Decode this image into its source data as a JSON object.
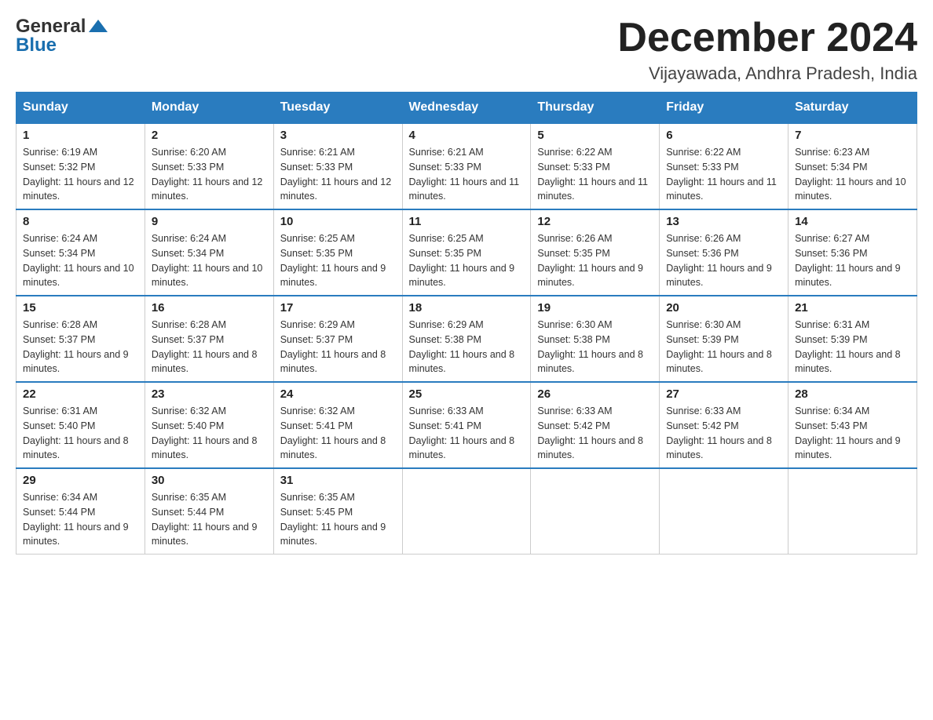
{
  "header": {
    "logo_general": "General",
    "logo_blue": "Blue",
    "month_title": "December 2024",
    "location": "Vijayawada, Andhra Pradesh, India"
  },
  "weekdays": [
    "Sunday",
    "Monday",
    "Tuesday",
    "Wednesday",
    "Thursday",
    "Friday",
    "Saturday"
  ],
  "weeks": [
    [
      {
        "day": "1",
        "sunrise": "6:19 AM",
        "sunset": "5:32 PM",
        "daylight": "11 hours and 12 minutes."
      },
      {
        "day": "2",
        "sunrise": "6:20 AM",
        "sunset": "5:33 PM",
        "daylight": "11 hours and 12 minutes."
      },
      {
        "day": "3",
        "sunrise": "6:21 AM",
        "sunset": "5:33 PM",
        "daylight": "11 hours and 12 minutes."
      },
      {
        "day": "4",
        "sunrise": "6:21 AM",
        "sunset": "5:33 PM",
        "daylight": "11 hours and 11 minutes."
      },
      {
        "day": "5",
        "sunrise": "6:22 AM",
        "sunset": "5:33 PM",
        "daylight": "11 hours and 11 minutes."
      },
      {
        "day": "6",
        "sunrise": "6:22 AM",
        "sunset": "5:33 PM",
        "daylight": "11 hours and 11 minutes."
      },
      {
        "day": "7",
        "sunrise": "6:23 AM",
        "sunset": "5:34 PM",
        "daylight": "11 hours and 10 minutes."
      }
    ],
    [
      {
        "day": "8",
        "sunrise": "6:24 AM",
        "sunset": "5:34 PM",
        "daylight": "11 hours and 10 minutes."
      },
      {
        "day": "9",
        "sunrise": "6:24 AM",
        "sunset": "5:34 PM",
        "daylight": "11 hours and 10 minutes."
      },
      {
        "day": "10",
        "sunrise": "6:25 AM",
        "sunset": "5:35 PM",
        "daylight": "11 hours and 9 minutes."
      },
      {
        "day": "11",
        "sunrise": "6:25 AM",
        "sunset": "5:35 PM",
        "daylight": "11 hours and 9 minutes."
      },
      {
        "day": "12",
        "sunrise": "6:26 AM",
        "sunset": "5:35 PM",
        "daylight": "11 hours and 9 minutes."
      },
      {
        "day": "13",
        "sunrise": "6:26 AM",
        "sunset": "5:36 PM",
        "daylight": "11 hours and 9 minutes."
      },
      {
        "day": "14",
        "sunrise": "6:27 AM",
        "sunset": "5:36 PM",
        "daylight": "11 hours and 9 minutes."
      }
    ],
    [
      {
        "day": "15",
        "sunrise": "6:28 AM",
        "sunset": "5:37 PM",
        "daylight": "11 hours and 9 minutes."
      },
      {
        "day": "16",
        "sunrise": "6:28 AM",
        "sunset": "5:37 PM",
        "daylight": "11 hours and 8 minutes."
      },
      {
        "day": "17",
        "sunrise": "6:29 AM",
        "sunset": "5:37 PM",
        "daylight": "11 hours and 8 minutes."
      },
      {
        "day": "18",
        "sunrise": "6:29 AM",
        "sunset": "5:38 PM",
        "daylight": "11 hours and 8 minutes."
      },
      {
        "day": "19",
        "sunrise": "6:30 AM",
        "sunset": "5:38 PM",
        "daylight": "11 hours and 8 minutes."
      },
      {
        "day": "20",
        "sunrise": "6:30 AM",
        "sunset": "5:39 PM",
        "daylight": "11 hours and 8 minutes."
      },
      {
        "day": "21",
        "sunrise": "6:31 AM",
        "sunset": "5:39 PM",
        "daylight": "11 hours and 8 minutes."
      }
    ],
    [
      {
        "day": "22",
        "sunrise": "6:31 AM",
        "sunset": "5:40 PM",
        "daylight": "11 hours and 8 minutes."
      },
      {
        "day": "23",
        "sunrise": "6:32 AM",
        "sunset": "5:40 PM",
        "daylight": "11 hours and 8 minutes."
      },
      {
        "day": "24",
        "sunrise": "6:32 AM",
        "sunset": "5:41 PM",
        "daylight": "11 hours and 8 minutes."
      },
      {
        "day": "25",
        "sunrise": "6:33 AM",
        "sunset": "5:41 PM",
        "daylight": "11 hours and 8 minutes."
      },
      {
        "day": "26",
        "sunrise": "6:33 AM",
        "sunset": "5:42 PM",
        "daylight": "11 hours and 8 minutes."
      },
      {
        "day": "27",
        "sunrise": "6:33 AM",
        "sunset": "5:42 PM",
        "daylight": "11 hours and 8 minutes."
      },
      {
        "day": "28",
        "sunrise": "6:34 AM",
        "sunset": "5:43 PM",
        "daylight": "11 hours and 9 minutes."
      }
    ],
    [
      {
        "day": "29",
        "sunrise": "6:34 AM",
        "sunset": "5:44 PM",
        "daylight": "11 hours and 9 minutes."
      },
      {
        "day": "30",
        "sunrise": "6:35 AM",
        "sunset": "5:44 PM",
        "daylight": "11 hours and 9 minutes."
      },
      {
        "day": "31",
        "sunrise": "6:35 AM",
        "sunset": "5:45 PM",
        "daylight": "11 hours and 9 minutes."
      },
      null,
      null,
      null,
      null
    ]
  ]
}
